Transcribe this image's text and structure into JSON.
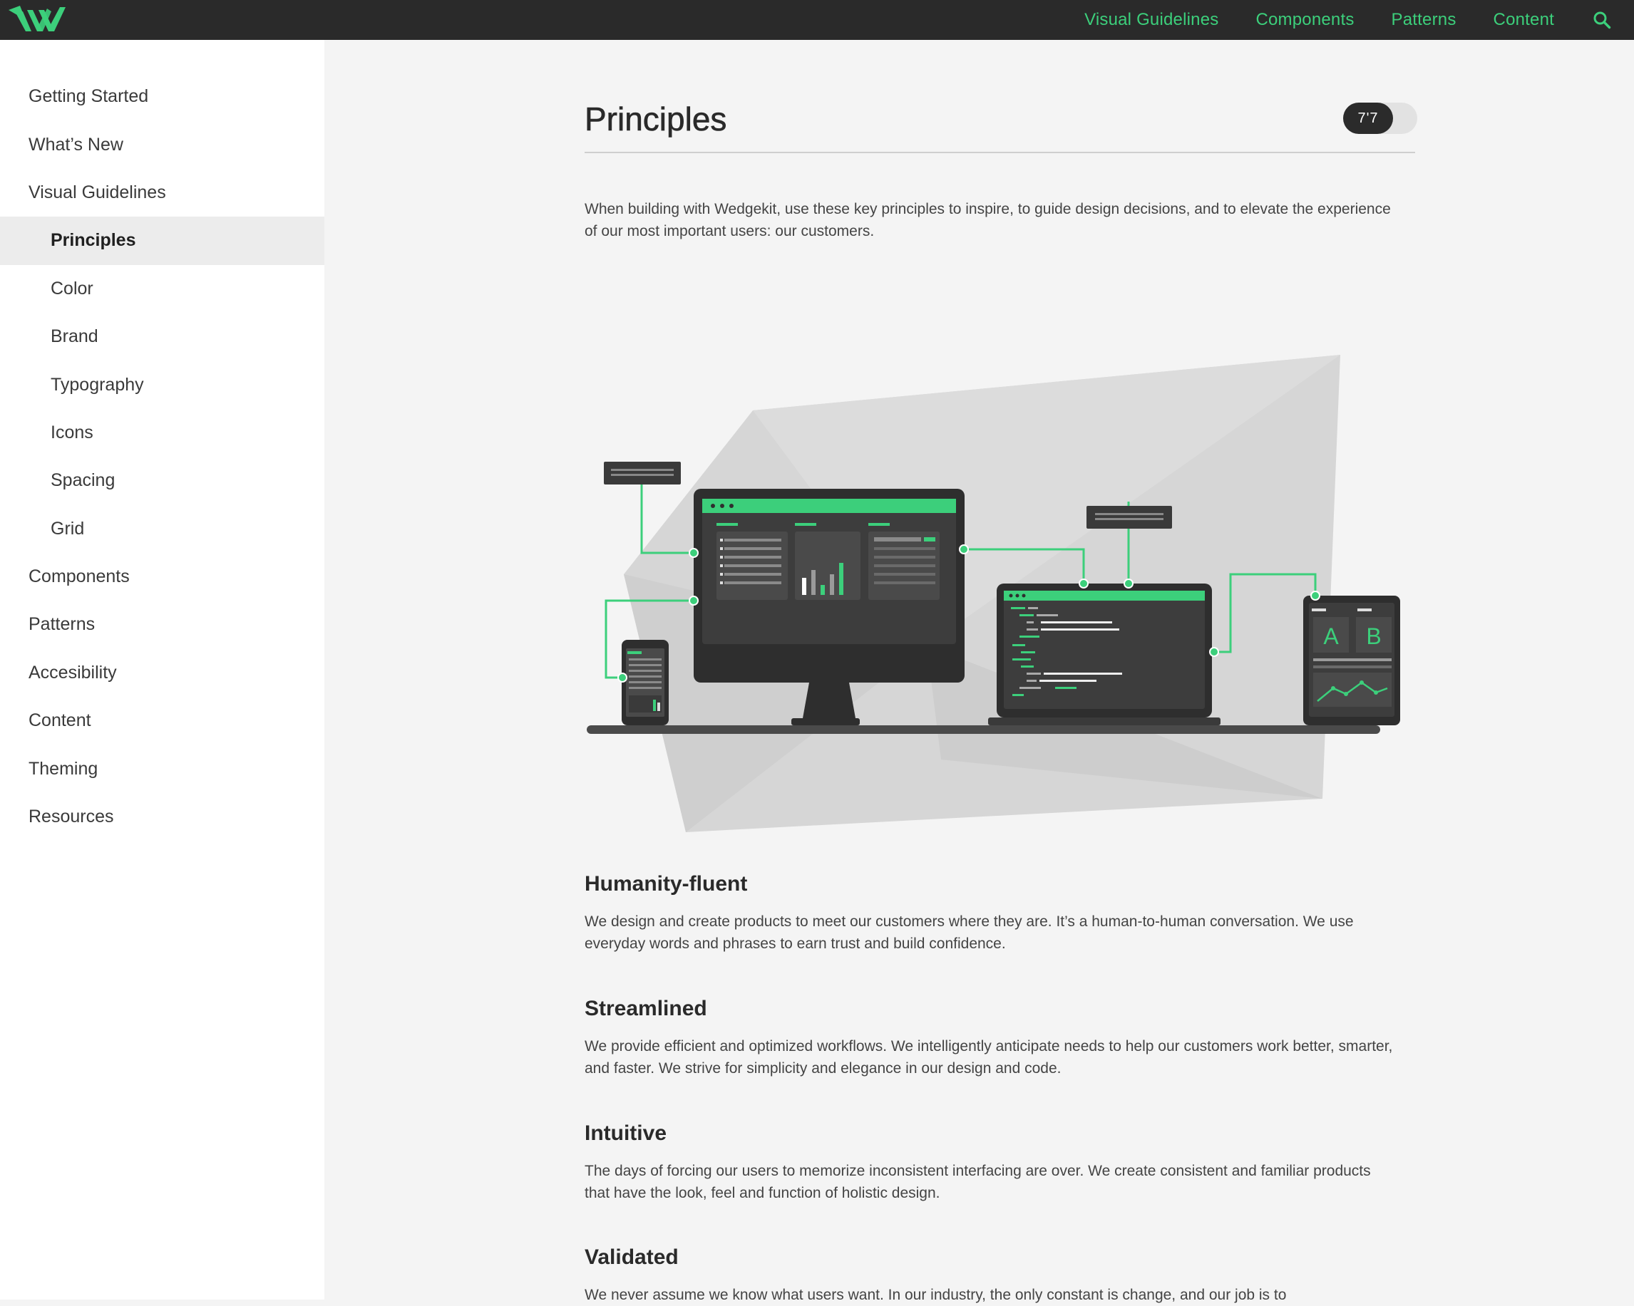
{
  "header": {
    "logo_icon": "wedgekit-logo-icon",
    "nav": [
      {
        "label": "Visual Guidelines"
      },
      {
        "label": "Components"
      },
      {
        "label": "Patterns"
      },
      {
        "label": "Content"
      }
    ],
    "search_icon": "search-icon",
    "accent_color": "#3ccf7b"
  },
  "sidebar": {
    "items": [
      {
        "label": "Getting Started"
      },
      {
        "label": "What’s New"
      },
      {
        "label": "Visual Guidelines"
      },
      {
        "label": "Principles"
      },
      {
        "label": "Color"
      },
      {
        "label": "Brand"
      },
      {
        "label": "Typography"
      },
      {
        "label": "Icons"
      },
      {
        "label": "Spacing"
      },
      {
        "label": "Grid"
      },
      {
        "label": "Components"
      },
      {
        "label": "Patterns"
      },
      {
        "label": "Accesibility"
      },
      {
        "label": "Content"
      },
      {
        "label": "Theming"
      },
      {
        "label": "Resources"
      }
    ],
    "active_item": "Principles"
  },
  "main": {
    "title": "Principles",
    "toggle": {
      "knob_label": "7'7"
    },
    "intro": "When building with Wedgekit, use these key principles to inspire, to guide design decisions, and to elevate the experience of our most important users: our customers.",
    "hero_illustration": {
      "tablet_labels": [
        "A",
        "B"
      ]
    },
    "principles": [
      {
        "title": "Humanity-fluent",
        "body": "We design and create products to meet our customers where they are. It’s a human-to-human conversation. We use everyday words and phrases to earn trust and build confidence."
      },
      {
        "title": "Streamlined",
        "body": "We provide efficient and optimized workflows. We intelligently anticipate needs to help our customers work better, smarter, and faster. We strive for simplicity and elegance in our design and code."
      },
      {
        "title": "Intuitive",
        "body": "The days of forcing our users to memorize inconsistent interfacing are over. We create consistent and familiar products that have the look, feel and function of holistic design."
      },
      {
        "title": "Validated",
        "body": "We never assume we know what users want. In our industry, the only constant is change, and our job is to"
      }
    ]
  }
}
